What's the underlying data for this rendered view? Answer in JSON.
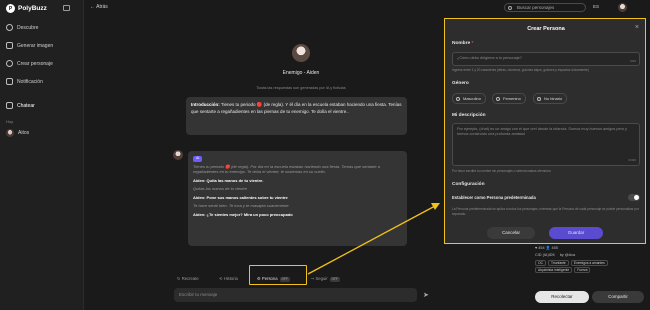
{
  "app": {
    "logo_text": "PolyBuzz"
  },
  "sidebar": {
    "items": [
      {
        "label": "Descubre",
        "icon": "compass-icon"
      },
      {
        "label": "Generar imagen",
        "icon": "image-icon"
      },
      {
        "label": "Crear personaje",
        "icon": "user-plus-icon"
      },
      {
        "label": "Notificación",
        "icon": "bell-icon"
      },
      {
        "label": "Chatear",
        "icon": "chat-icon"
      }
    ],
    "section_label": "Hoy",
    "recent_chat": "Aitos"
  },
  "header": {
    "back_label": "Atrás",
    "search_placeholder": "Buscar personajes",
    "lang": "ES"
  },
  "chat": {
    "character_name": "Enemigo - Aiden",
    "disclaimer": "Todas las respuestas son generadas por IA y ficticias",
    "intro_label": "Introducción:",
    "intro_text": "Tienes tu periodo 🔴 (de regla). Y él día en la escuela estaban haciendo una fiesta. Tenías que sentarte a regañadientes en las piernas de tu enemigo. Te dolía el vientre..",
    "msg_badge": "AI",
    "msg_lines": [
      {
        "kind": "it",
        "text": "Tienes tu periodo 🔴 (de regla). Por día en la escuela estaban haciendo una fiesta. Tenías que sentarte a regañadientes en tu enemigo. Te dolía el vientre, te sostenías en su cuello."
      },
      {
        "kind": "sp",
        "text": "Aiden: Quita las manos de tu vientre."
      },
      {
        "kind": "it",
        "text": "Quitas las manos de tu vientre"
      },
      {
        "kind": "sp",
        "text": "Aiden: Pone sus manos calientes sobre tu vientre"
      },
      {
        "kind": "it",
        "text": "Te hace sentir bien. Te toca y te masajea suavemente"
      },
      {
        "kind": "sp",
        "text": "Aiden: ¿Te sientes mejor? Mira un poco preocupado"
      }
    ],
    "toolbar": {
      "regenerate": "Recreate",
      "history": "Historia",
      "persona": "Persona",
      "persona_tag": "OFF",
      "seguir": "Seguir",
      "seguir_tag": "OFF"
    },
    "input_placeholder": "Escribir tu mensaje"
  },
  "modal": {
    "title": "Crear Persona",
    "name_label": "Nombre",
    "name_placeholder": "¿Cómo debo dirigirme a tu personaje?",
    "name_counter": "0/20",
    "name_hint": "Ingrese entre 1 y 20 caracteres (letras, números, guiones bajos, guiones y espacios únicamente)",
    "gender_label": "Género",
    "genders": [
      "Masculino",
      "Femenino",
      "No binario"
    ],
    "desc_label": "Mi descripción",
    "desc_placeholder": "Por ejemplo, (chat) es un amigo con el que creí desde la infancia. Somos muy buenos amigos pero y hemos construido una profunda amistad",
    "desc_counter": "0/300",
    "desc_hint": "Por favor escribe tu nombre sin personajes o seleccionados ofensivos",
    "config_label": "Configuración",
    "default_toggle_label": "Establecer como Persona predeterminada",
    "default_hint": "La Persona predeterminada se aplica a todos los personajes, mientras que la Persona de cada personaje se puede personalizar por separado.",
    "cancel": "Cancelar",
    "save": "Guardar"
  },
  "right_panel": {
    "stats": "♥ 454   👤 455",
    "ai_label": "CID (IA)ID5",
    "by": "by @Ava",
    "tags": [
      "OC",
      "Triunfante",
      "Enemigos a amantes",
      "Alquimista inteligente",
      "Fuerza"
    ],
    "recolectar": "Recolectar",
    "compartir": "Compartir"
  },
  "colors": {
    "accent": "#f2c11a",
    "primary": "#5a4bd0",
    "background": "#1a1a1a"
  }
}
